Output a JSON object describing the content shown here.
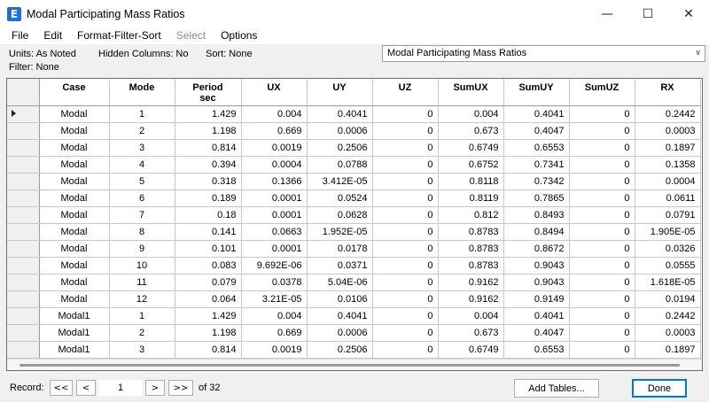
{
  "window": {
    "app_icon_letter": "E",
    "title": "Modal Participating Mass Ratios",
    "minimize_glyph": "—",
    "maximize_glyph": "☐",
    "close_glyph": "✕"
  },
  "menu": [
    {
      "label": "File",
      "enabled": true
    },
    {
      "label": "Edit",
      "enabled": true
    },
    {
      "label": "Format-Filter-Sort",
      "enabled": true
    },
    {
      "label": "Select",
      "enabled": false
    },
    {
      "label": "Options",
      "enabled": true
    }
  ],
  "info": {
    "units": "Units:  As Noted",
    "hidden_columns": "Hidden Columns:  No",
    "sort": "Sort:  None",
    "filter": "Filter:  None",
    "table_select": "Modal Participating Mass Ratios"
  },
  "table": {
    "columns": [
      "Case",
      "Mode",
      "Period\nsec",
      "UX",
      "UY",
      "UZ",
      "SumUX",
      "SumUY",
      "SumUZ",
      "RX"
    ],
    "rows": [
      [
        "Modal",
        "1",
        "1.429",
        "0.004",
        "0.4041",
        "0",
        "0.004",
        "0.4041",
        "0",
        "0.2442"
      ],
      [
        "Modal",
        "2",
        "1.198",
        "0.669",
        "0.0006",
        "0",
        "0.673",
        "0.4047",
        "0",
        "0.0003"
      ],
      [
        "Modal",
        "3",
        "0.814",
        "0.0019",
        "0.2506",
        "0",
        "0.6749",
        "0.6553",
        "0",
        "0.1897"
      ],
      [
        "Modal",
        "4",
        "0.394",
        "0.0004",
        "0.0788",
        "0",
        "0.6752",
        "0.7341",
        "0",
        "0.1358"
      ],
      [
        "Modal",
        "5",
        "0.318",
        "0.1366",
        "3.412E-05",
        "0",
        "0.8118",
        "0.7342",
        "0",
        "0.0004"
      ],
      [
        "Modal",
        "6",
        "0.189",
        "0.0001",
        "0.0524",
        "0",
        "0.8119",
        "0.7865",
        "0",
        "0.0611"
      ],
      [
        "Modal",
        "7",
        "0.18",
        "0.0001",
        "0.0628",
        "0",
        "0.812",
        "0.8493",
        "0",
        "0.0791"
      ],
      [
        "Modal",
        "8",
        "0.141",
        "0.0663",
        "1.952E-05",
        "0",
        "0.8783",
        "0.8494",
        "0",
        "1.905E-05"
      ],
      [
        "Modal",
        "9",
        "0.101",
        "0.0001",
        "0.0178",
        "0",
        "0.8783",
        "0.8672",
        "0",
        "0.0326"
      ],
      [
        "Modal",
        "10",
        "0.083",
        "9.692E-06",
        "0.0371",
        "0",
        "0.8783",
        "0.9043",
        "0",
        "0.0555"
      ],
      [
        "Modal",
        "11",
        "0.079",
        "0.0378",
        "5.04E-06",
        "0",
        "0.9162",
        "0.9043",
        "0",
        "1.618E-05"
      ],
      [
        "Modal",
        "12",
        "0.064",
        "3.21E-05",
        "0.0106",
        "0",
        "0.9162",
        "0.9149",
        "0",
        "0.0194"
      ],
      [
        "Modal1",
        "1",
        "1.429",
        "0.004",
        "0.4041",
        "0",
        "0.004",
        "0.4041",
        "0",
        "0.2442"
      ],
      [
        "Modal1",
        "2",
        "1.198",
        "0.669",
        "0.0006",
        "0",
        "0.673",
        "0.4047",
        "0",
        "0.0003"
      ],
      [
        "Modal1",
        "3",
        "0.814",
        "0.0019",
        "0.2506",
        "0",
        "0.6749",
        "0.6553",
        "0",
        "0.1897"
      ]
    ],
    "current_row": 0
  },
  "status": {
    "record_label": "Record:",
    "first_label": "<<",
    "prev_label": "<",
    "record_value": "1",
    "next_label": ">",
    "last_label": ">>",
    "of_label": "of 32",
    "add_tables_label": "Add Tables...",
    "done_label": "Done"
  }
}
